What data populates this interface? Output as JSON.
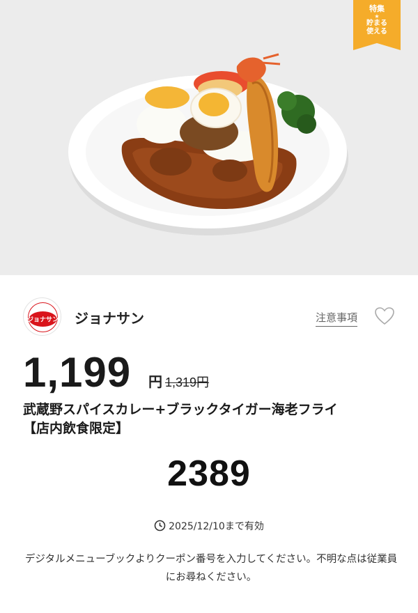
{
  "ribbon": {
    "line1": "特集",
    "line2": "★",
    "line3": "貯まる\n使える"
  },
  "brand": {
    "name": "ジョナサン",
    "logo_text": "ジョナサン"
  },
  "notice_label": "注意事項",
  "price": {
    "current": "1,199",
    "unit": "円",
    "original": "1,319円"
  },
  "product": {
    "title_line1": "武蔵野スパイスカレー+ブラックタイガー海老フライ",
    "title_line2": "【店内飲食限定】"
  },
  "coupon": {
    "code": "2389"
  },
  "expiry": {
    "text": "2025/12/10まで有効"
  },
  "instructions": "デジタルメニューブックよりクーポン番号を入力してください。不明な点は従業員にお尋ねください。",
  "colors": {
    "ribbon": "#f5ac2a",
    "logo_red": "#d9141b",
    "hero_bg": "#ececec"
  }
}
